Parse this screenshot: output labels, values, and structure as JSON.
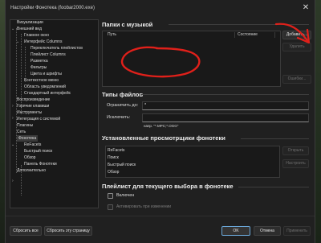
{
  "window": {
    "title": "Настройки Фонотека (foobar2000.exe)",
    "close_glyph": "✕"
  },
  "tree": {
    "items": [
      {
        "label": "Визуализации"
      },
      {
        "label": "Внешний вид",
        "expanded": true
      },
      {
        "label": "Главное окно"
      },
      {
        "label": "Интерфейс Columns",
        "expanded": true
      },
      {
        "label": "Переключатель плейлистов"
      },
      {
        "label": "Плейлист Columns"
      },
      {
        "label": "Разметка"
      },
      {
        "label": "Фильтры"
      },
      {
        "label": "Цвета и шрифты"
      },
      {
        "label": "Контекстное меню"
      },
      {
        "label": "Область уведомлений"
      },
      {
        "label": "Стандартный интерфейс"
      },
      {
        "label": "Воспроизведение",
        "expanded": false
      },
      {
        "label": "Горячие клавиши"
      },
      {
        "label": "Инструменты",
        "expanded": false
      },
      {
        "label": "Интеграция с системой"
      },
      {
        "label": "Плагины"
      },
      {
        "label": "Сеть"
      },
      {
        "label": "Фонотека",
        "expanded": true,
        "selected": true
      },
      {
        "label": "ReFacets"
      },
      {
        "label": "Быстрый поиск"
      },
      {
        "label": "Обзор"
      },
      {
        "label": "Панель Фонотеки"
      },
      {
        "label": "Дополнительно",
        "expanded": false
      }
    ]
  },
  "music_folders": {
    "header": "Папки с музыкой",
    "col_path": "Путь",
    "col_state": "Состояние",
    "add_button": "Добавить...",
    "remove_button": "Удалить",
    "errors_button": "Ошибки..."
  },
  "file_types": {
    "header": "Типы файлов",
    "restrict_label": "Ограничить до:",
    "restrict_value": "*",
    "exclude_label": "Исключить:",
    "hint": "напр. \"*.MPC;*.OGG\""
  },
  "viewers": {
    "header": "Установленные просмотрщики фонотеки",
    "items": [
      "ReFacets",
      "Поиск",
      "Быстрый поиск",
      "Обзор"
    ],
    "open_button": "Открыть",
    "configure_button": "Настроить"
  },
  "playlist": {
    "header": "Плейлист для текущего выбора в фонотеке",
    "enabled_label": "Включен",
    "activate_label": "Активировать при изменении"
  },
  "footer": {
    "reset_all": "Сбросить все",
    "reset_page": "Сбросить эту страницу",
    "ok": "OK",
    "cancel": "Отмена",
    "apply": "Применить"
  },
  "annotation": {
    "color": "#e0201a"
  },
  "tree_glyphs": {
    "expanded": "⌄",
    "collapsed": "›"
  },
  "combo_glyph": "⌄"
}
